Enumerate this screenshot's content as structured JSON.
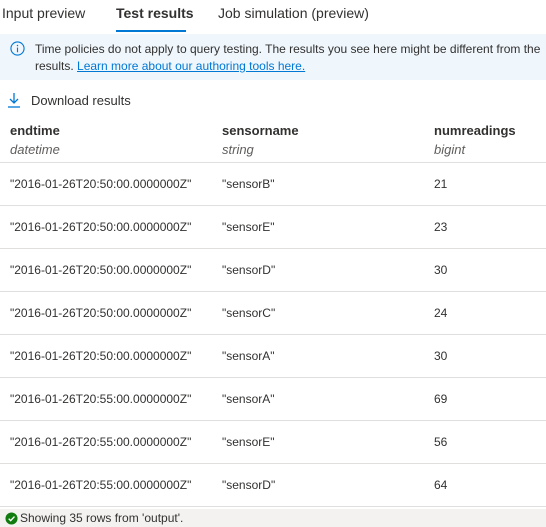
{
  "tabs": [
    {
      "label": "Input preview",
      "selected": false
    },
    {
      "label": "Test results",
      "selected": true
    },
    {
      "label": "Job simulation (preview)",
      "selected": false
    }
  ],
  "info": {
    "icon": "info-icon",
    "text": "Time policies do not apply to query testing. The results you see here might be different from the results.",
    "link": "Learn more about our authoring tools here."
  },
  "toolbar": {
    "download_label": "Download results",
    "download_icon": "download-icon"
  },
  "table": {
    "columns": [
      {
        "name": "endtime",
        "type": "datetime"
      },
      {
        "name": "sensorname",
        "type": "string"
      },
      {
        "name": "numreadings",
        "type": "bigint"
      }
    ],
    "rows": [
      [
        "\"2016-01-26T20:50:00.0000000Z\"",
        "\"sensorB\"",
        "21"
      ],
      [
        "\"2016-01-26T20:50:00.0000000Z\"",
        "\"sensorE\"",
        "23"
      ],
      [
        "\"2016-01-26T20:50:00.0000000Z\"",
        "\"sensorD\"",
        "30"
      ],
      [
        "\"2016-01-26T20:50:00.0000000Z\"",
        "\"sensorC\"",
        "24"
      ],
      [
        "\"2016-01-26T20:50:00.0000000Z\"",
        "\"sensorA\"",
        "30"
      ],
      [
        "\"2016-01-26T20:55:00.0000000Z\"",
        "\"sensorA\"",
        "69"
      ],
      [
        "\"2016-01-26T20:55:00.0000000Z\"",
        "\"sensorE\"",
        "56"
      ],
      [
        "\"2016-01-26T20:55:00.0000000Z\"",
        "\"sensorD\"",
        "64"
      ]
    ]
  },
  "status": {
    "text": "Showing 35 rows from 'output'.",
    "icon": "success-check-icon",
    "color": "#107c10"
  },
  "colors": {
    "accent": "#0078d4",
    "info_bg": "#eff6fc"
  }
}
